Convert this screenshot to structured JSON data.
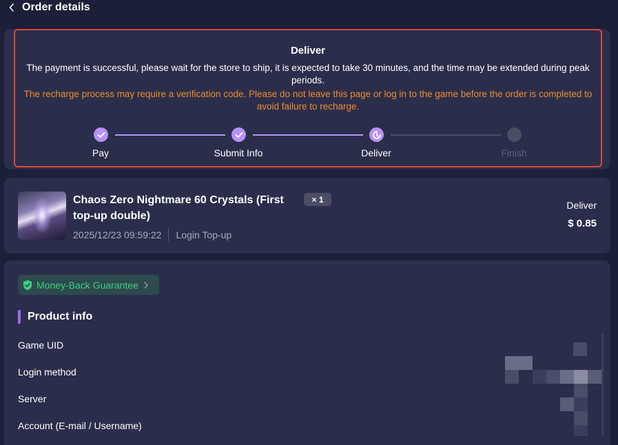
{
  "header": {
    "title": "Order details",
    "back_icon": "chevron-left-icon"
  },
  "status": {
    "title": "Deliver",
    "message": "The payment is successful, please wait for the store to ship, it is expected to take 30 minutes, and the time may be extended during peak periods.",
    "warning": "The recharge process may require a verification code. Please do not leave this page or log in to the game before the order is completed to avoid failure to recharge.",
    "warning_color": "#f08a2c",
    "border_color": "#e2463a",
    "steps": [
      {
        "label": "Pay",
        "state": "done",
        "icon": "check-icon"
      },
      {
        "label": "Submit Info",
        "state": "done",
        "icon": "check-icon"
      },
      {
        "label": "Deliver",
        "state": "current",
        "icon": "clock-icon"
      },
      {
        "label": "Finish",
        "state": "pending",
        "icon": "dot-icon"
      }
    ],
    "accent_color": "#b692f6"
  },
  "product": {
    "name": "Chaos Zero Nightmare 60 Crystals (First top-up double)",
    "quantity": "× 1",
    "timestamp": "2025/12/23 09:59:22",
    "type": "Login Top-up",
    "status": "Deliver",
    "price": "$ 0.85"
  },
  "info": {
    "guarantee": "Money-Back Guarantee",
    "guarantee_color": "#3ed07c",
    "section_title": "Product info",
    "rows": [
      {
        "label": "Game UID"
      },
      {
        "label": "Login method"
      },
      {
        "label": "Server"
      },
      {
        "label": "Account (E-mail / Username)"
      }
    ]
  }
}
